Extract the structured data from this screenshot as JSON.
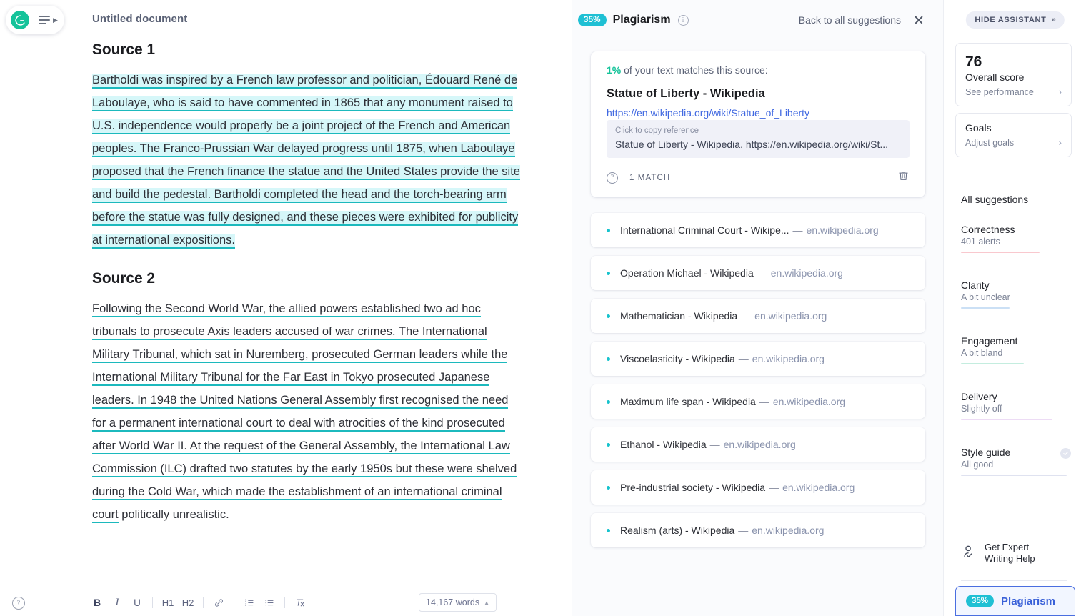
{
  "brand": {
    "logo_letter": "G"
  },
  "editor": {
    "doc_title": "Untitled document",
    "sections": [
      {
        "heading": "Source 1",
        "text": "Bartholdi was inspired by a French law professor and politician, Édouard René de Laboulaye, who is said to have commented in 1865 that any monument raised to U.S. independence would properly be a joint project of the French and American peoples. The Franco-Prussian War delayed progress until 1875, when Laboulaye proposed that the French finance the statue and the United States provide the site and build the pedestal. Bartholdi completed the head and the torch-bearing arm before the statue was fully designed, and these pieces were exhibited for publicity at international expositions.",
        "style": "highlight"
      },
      {
        "heading": "Source 2",
        "text_marked": "Following the Second World War, the allied powers established two ad hoc tribunals to prosecute Axis leaders accused of war crimes. The International Military Tribunal, which sat in Nuremberg, prosecuted German leaders while the International Military Tribunal for the Far East in Tokyo prosecuted Japanese leaders. In 1948 the United Nations General Assembly first recognised the need for a permanent international court to deal with atrocities of the kind prosecuted after World War II. At the request of the General Assembly, the International Law Commission (ILC) drafted two statutes by the early 1950s but these were shelved during the Cold War, which made the establishment of an international criminal court",
        "text_plain": " politically unrealistic.",
        "style": "underline"
      }
    ],
    "toolbar": {
      "bold": "B",
      "italic": "I",
      "underline": "U",
      "h1": "H1",
      "h2": "H2",
      "link": "link-icon",
      "numbered_list": "numbered-list-icon",
      "bulleted_list": "bulleted-list-icon",
      "clear_format": "clear-formatting-icon",
      "word_count": "14,167 words"
    },
    "help": "?"
  },
  "suggestions_panel": {
    "percent_badge": "35%",
    "title": "Plagiarism",
    "info": "i",
    "back_link": "Back to all suggestions",
    "source_card": {
      "match_percent": "1%",
      "match_text": " of your text matches this source:",
      "source_title": "Statue of Liberty - Wikipedia",
      "source_url": "https://en.wikipedia.org/wiki/Statue_of_Liberty",
      "copy_label": "Click to copy reference",
      "reference": "Statue of Liberty - Wikipedia. https://en.wikipedia.org/wiki/St...",
      "help": "?",
      "match_count": "1 MATCH",
      "delete": "trash-icon"
    },
    "items": [
      {
        "title": "International Criminal Court - Wikipe...",
        "dash": "—",
        "domain": "en.wikipedia.org"
      },
      {
        "title": "Operation Michael - Wikipedia",
        "dash": "—",
        "domain": "en.wikipedia.org"
      },
      {
        "title": "Mathematician - Wikipedia",
        "dash": "—",
        "domain": "en.wikipedia.org"
      },
      {
        "title": "Viscoelasticity - Wikipedia",
        "dash": "—",
        "domain": "en.wikipedia.org"
      },
      {
        "title": "Maximum life span - Wikipedia",
        "dash": "—",
        "domain": "en.wikipedia.org"
      },
      {
        "title": "Ethanol - Wikipedia",
        "dash": "—",
        "domain": "en.wikipedia.org"
      },
      {
        "title": "Pre-industrial society - Wikipedia",
        "dash": "—",
        "domain": "en.wikipedia.org"
      },
      {
        "title": "Realism (arts) - Wikipedia",
        "dash": "—",
        "domain": "en.wikipedia.org"
      }
    ]
  },
  "assistant": {
    "hide_label": "HIDE ASSISTANT",
    "hide_arrows": "»",
    "score": {
      "value": "76",
      "label": "Overall score",
      "sub": "See performance"
    },
    "goals": {
      "label": "Goals",
      "sub": "Adjust goals"
    },
    "all_suggestions": "All suggestions",
    "categories": [
      {
        "name": "Correctness",
        "sub": "401 alerts",
        "color": "#f9c8ce",
        "checked": false
      },
      {
        "name": "Clarity",
        "sub": "A bit unclear",
        "color": "#cbe0f5",
        "checked": false
      },
      {
        "name": "Engagement",
        "sub": "A bit bland",
        "color": "#c4eddf",
        "checked": false
      },
      {
        "name": "Delivery",
        "sub": "Slightly off",
        "color": "#eddcf5",
        "checked": false
      },
      {
        "name": "Style guide",
        "sub": "All good",
        "color": "#dfe2f0",
        "checked": true
      }
    ],
    "expert": {
      "line1": "Get Expert",
      "line2": "Writing Help",
      "icon": "person-check-icon"
    },
    "plagiarism_btn": {
      "percent": "35%",
      "label": "Plagiarism"
    }
  },
  "colors": {
    "accent_green": "#15c39a",
    "accent_teal": "#1fc0d4",
    "highlight_bg": "#d6f7f9",
    "underline": "#1cb9bd",
    "link_blue": "#4169e1",
    "plag_blue": "#3a61d8"
  }
}
